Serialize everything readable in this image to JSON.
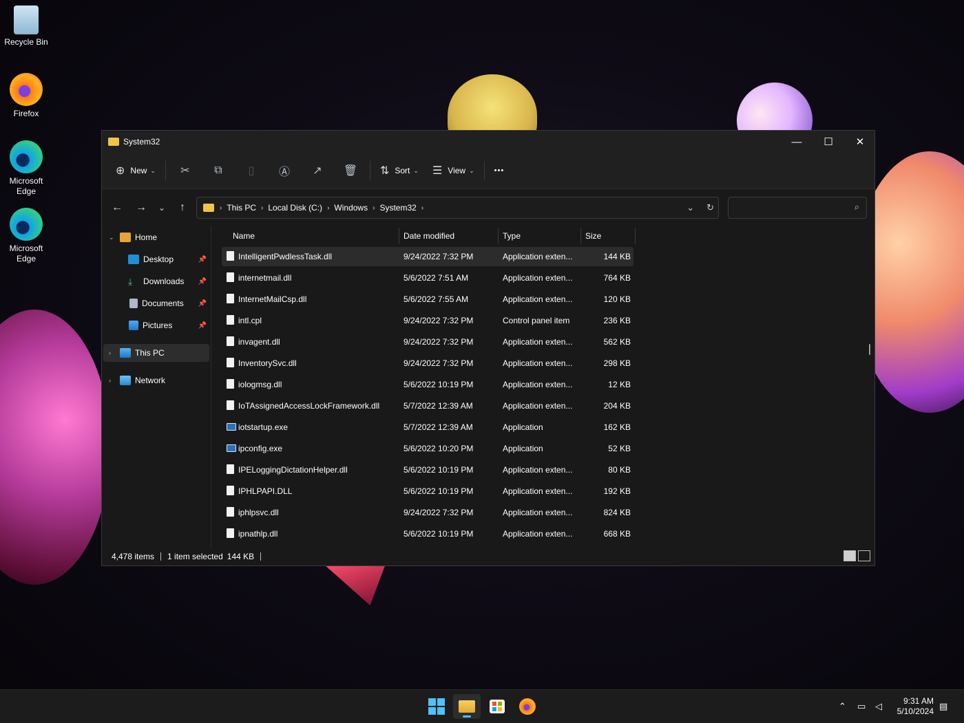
{
  "desktop": {
    "icons": [
      {
        "label": "Recycle Bin"
      },
      {
        "label": "Firefox"
      },
      {
        "label": "Microsoft Edge"
      },
      {
        "label": "Microsoft Edge"
      }
    ]
  },
  "window": {
    "title": "System32",
    "controls": {
      "minimize": "—",
      "maximize": "☐",
      "close": "✕"
    }
  },
  "toolbar": {
    "new_label": "New",
    "sort_label": "Sort",
    "view_label": "View",
    "more_label": "•••"
  },
  "address": {
    "crumbs": [
      "This PC",
      "Local Disk (C:)",
      "Windows",
      "System32"
    ],
    "search_value": "",
    "search_placeholder": ""
  },
  "nav_pane": {
    "items": [
      {
        "label": "Home"
      },
      {
        "label": "Desktop"
      },
      {
        "label": "Downloads"
      },
      {
        "label": "Documents"
      },
      {
        "label": "Pictures"
      },
      {
        "label": "This PC"
      },
      {
        "label": "Network"
      }
    ]
  },
  "file_list": {
    "columns": [
      "Name",
      "Date modified",
      "Type",
      "Size"
    ],
    "rows": [
      {
        "name": "IntelligentPwdlessTask.dll",
        "date": "9/24/2022 7:32 PM",
        "type": "Application exten...",
        "size": "144 KB",
        "icon": "dll"
      },
      {
        "name": "internetmail.dll",
        "date": "5/6/2022 7:51 AM",
        "type": "Application exten...",
        "size": "764 KB",
        "icon": "dll"
      },
      {
        "name": "InternetMailCsp.dll",
        "date": "5/6/2022 7:55 AM",
        "type": "Application exten...",
        "size": "120 KB",
        "icon": "dll"
      },
      {
        "name": "intl.cpl",
        "date": "9/24/2022 7:32 PM",
        "type": "Control panel item",
        "size": "236 KB",
        "icon": "dll"
      },
      {
        "name": "invagent.dll",
        "date": "9/24/2022 7:32 PM",
        "type": "Application exten...",
        "size": "562 KB",
        "icon": "dll"
      },
      {
        "name": "InventorySvc.dll",
        "date": "9/24/2022 7:32 PM",
        "type": "Application exten...",
        "size": "298 KB",
        "icon": "dll"
      },
      {
        "name": "iologmsg.dll",
        "date": "5/6/2022 10:19 PM",
        "type": "Application exten...",
        "size": "12 KB",
        "icon": "dll"
      },
      {
        "name": "IoTAssignedAccessLockFramework.dll",
        "date": "5/7/2022 12:39 AM",
        "type": "Application exten...",
        "size": "204 KB",
        "icon": "dll"
      },
      {
        "name": "iotstartup.exe",
        "date": "5/7/2022 12:39 AM",
        "type": "Application",
        "size": "162 KB",
        "icon": "exe"
      },
      {
        "name": "ipconfig.exe",
        "date": "5/6/2022 10:20 PM",
        "type": "Application",
        "size": "52 KB",
        "icon": "exe"
      },
      {
        "name": "IPELoggingDictationHelper.dll",
        "date": "5/6/2022 10:19 PM",
        "type": "Application exten...",
        "size": "80 KB",
        "icon": "dll"
      },
      {
        "name": "IPHLPAPI.DLL",
        "date": "5/6/2022 10:19 PM",
        "type": "Application exten...",
        "size": "192 KB",
        "icon": "dll"
      },
      {
        "name": "iphlpsvc.dll",
        "date": "9/24/2022 7:32 PM",
        "type": "Application exten...",
        "size": "824 KB",
        "icon": "dll"
      },
      {
        "name": "ipnathlp.dll",
        "date": "5/6/2022 10:19 PM",
        "type": "Application exten...",
        "size": "668 KB",
        "icon": "dll"
      }
    ],
    "selected_index": 0
  },
  "status": {
    "item_count": "4,478 items",
    "selection": "1 item selected",
    "selection_size": "144 KB"
  },
  "taskbar": {
    "time": "9:31 AM",
    "date": "5/10/2024"
  },
  "colors": {
    "accent": "#4cc2ff",
    "folder": "#f0c34a",
    "window_bg": "#191919"
  }
}
